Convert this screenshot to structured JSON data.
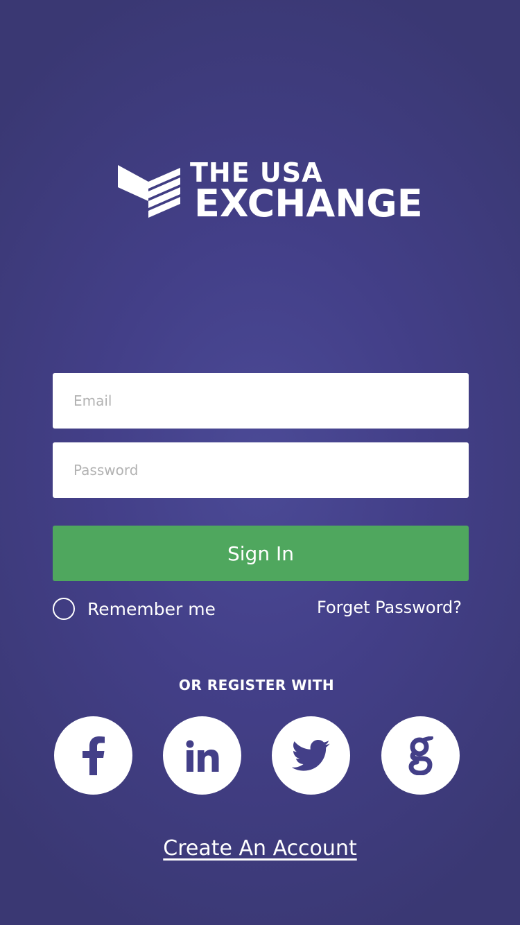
{
  "logo": {
    "line1": "THE USA",
    "line2": "EXCHANGE"
  },
  "form": {
    "email_placeholder": "Email",
    "password_placeholder": "Password",
    "signin_label": "Sign In",
    "remember_label": "Remember me",
    "forgot_label": "Forget Password?"
  },
  "social": {
    "heading": "OR REGISTER WITH",
    "providers": [
      {
        "name": "facebook",
        "icon": "facebook-icon"
      },
      {
        "name": "linkedin",
        "icon": "linkedin-icon"
      },
      {
        "name": "twitter",
        "icon": "twitter-icon"
      },
      {
        "name": "goodreads",
        "icon": "g-icon"
      }
    ]
  },
  "footer": {
    "create_account_label": "Create An Account"
  },
  "colors": {
    "background": "#433f88",
    "accent_green": "#4fa75e",
    "icon": "#433f88"
  }
}
